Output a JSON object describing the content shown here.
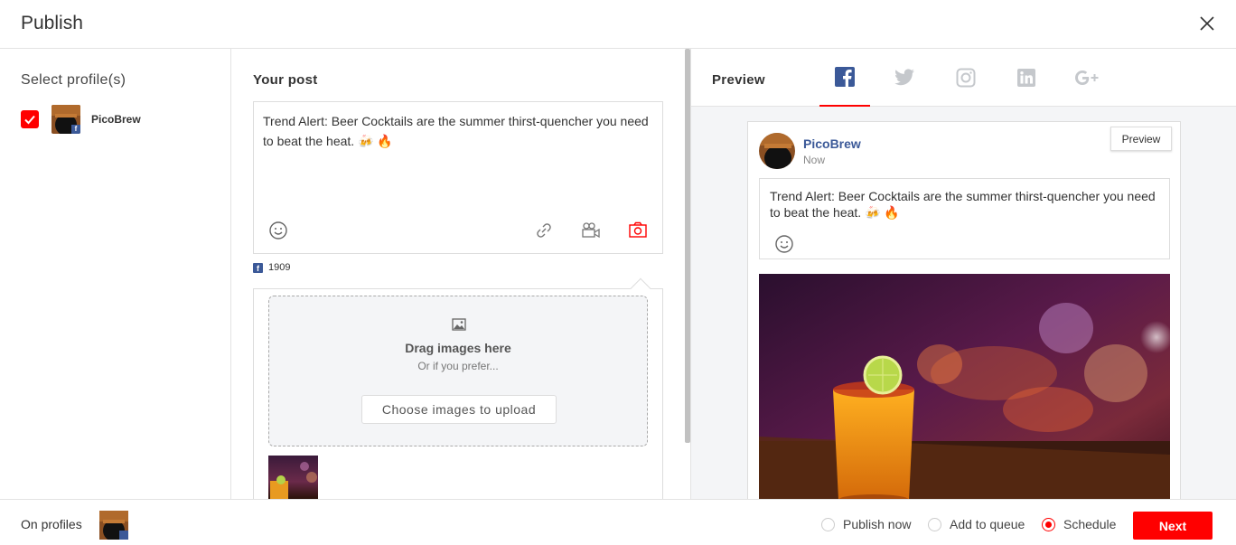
{
  "header": {
    "title": "Publish",
    "close_icon": "close-icon"
  },
  "profiles": {
    "heading": "Select profile(s)",
    "items": [
      {
        "name": "PicoBrew",
        "checked": true,
        "network": "facebook"
      }
    ]
  },
  "composer": {
    "heading": "Your post",
    "text": "Trend Alert: Beer Cocktails are the summer thirst-quencher you need to beat the heat. 🍻 🔥",
    "tools": [
      "emoji-icon",
      "link-icon",
      "video-camera-icon",
      "photo-camera-icon"
    ],
    "active_tool_color": "#ff0000",
    "char_count": "1909"
  },
  "upload": {
    "drag_text": "Drag images here",
    "prefer_text": "Or if you prefer...",
    "choose_label": "Choose images to upload"
  },
  "preview": {
    "label": "Preview",
    "networks": [
      "facebook-icon",
      "twitter-icon",
      "instagram-icon",
      "linkedin-icon",
      "google-plus-icon"
    ],
    "active_network": "facebook",
    "card": {
      "name": "PicoBrew",
      "time": "Now",
      "preview_button": "Preview",
      "text": "Trend Alert: Beer Cocktails are the summer thirst-quencher you need to beat the heat. 🍻 🔥"
    }
  },
  "footer": {
    "on_profiles": "On profiles",
    "options": [
      {
        "label": "Publish now",
        "selected": false
      },
      {
        "label": "Add to queue",
        "selected": false
      },
      {
        "label": "Schedule",
        "selected": true
      }
    ],
    "next_label": "Next"
  },
  "colors": {
    "accent": "#ff0000",
    "facebook": "#3b5998",
    "name_link": "#3b5998"
  }
}
